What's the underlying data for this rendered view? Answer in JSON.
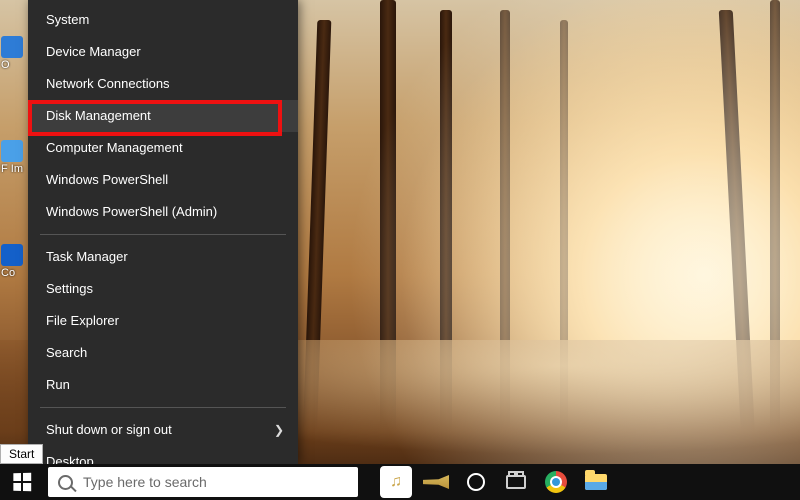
{
  "desktop_icons": [
    {
      "label": "O"
    },
    {
      "label": "F\nIm"
    },
    {
      "label": "Co"
    }
  ],
  "winx_menu": {
    "groups": [
      [
        {
          "key": "system",
          "label": "System"
        },
        {
          "key": "devmgr",
          "label": "Device Manager"
        },
        {
          "key": "netconn",
          "label": "Network Connections"
        },
        {
          "key": "diskmgmt",
          "label": "Disk Management",
          "highlighted": true
        },
        {
          "key": "compmgmt",
          "label": "Computer Management"
        },
        {
          "key": "psh",
          "label": "Windows PowerShell"
        },
        {
          "key": "pshadmin",
          "label": "Windows PowerShell (Admin)"
        }
      ],
      [
        {
          "key": "taskmgr",
          "label": "Task Manager"
        },
        {
          "key": "settings",
          "label": "Settings"
        },
        {
          "key": "explorer",
          "label": "File Explorer"
        },
        {
          "key": "search",
          "label": "Search"
        },
        {
          "key": "run",
          "label": "Run"
        }
      ],
      [
        {
          "key": "shutdown",
          "label": "Shut down or sign out",
          "submenu": true
        },
        {
          "key": "desktop",
          "label": "Desktop"
        }
      ]
    ]
  },
  "tooltip_start": "Start",
  "taskbar": {
    "search_placeholder": "Type here to search"
  }
}
